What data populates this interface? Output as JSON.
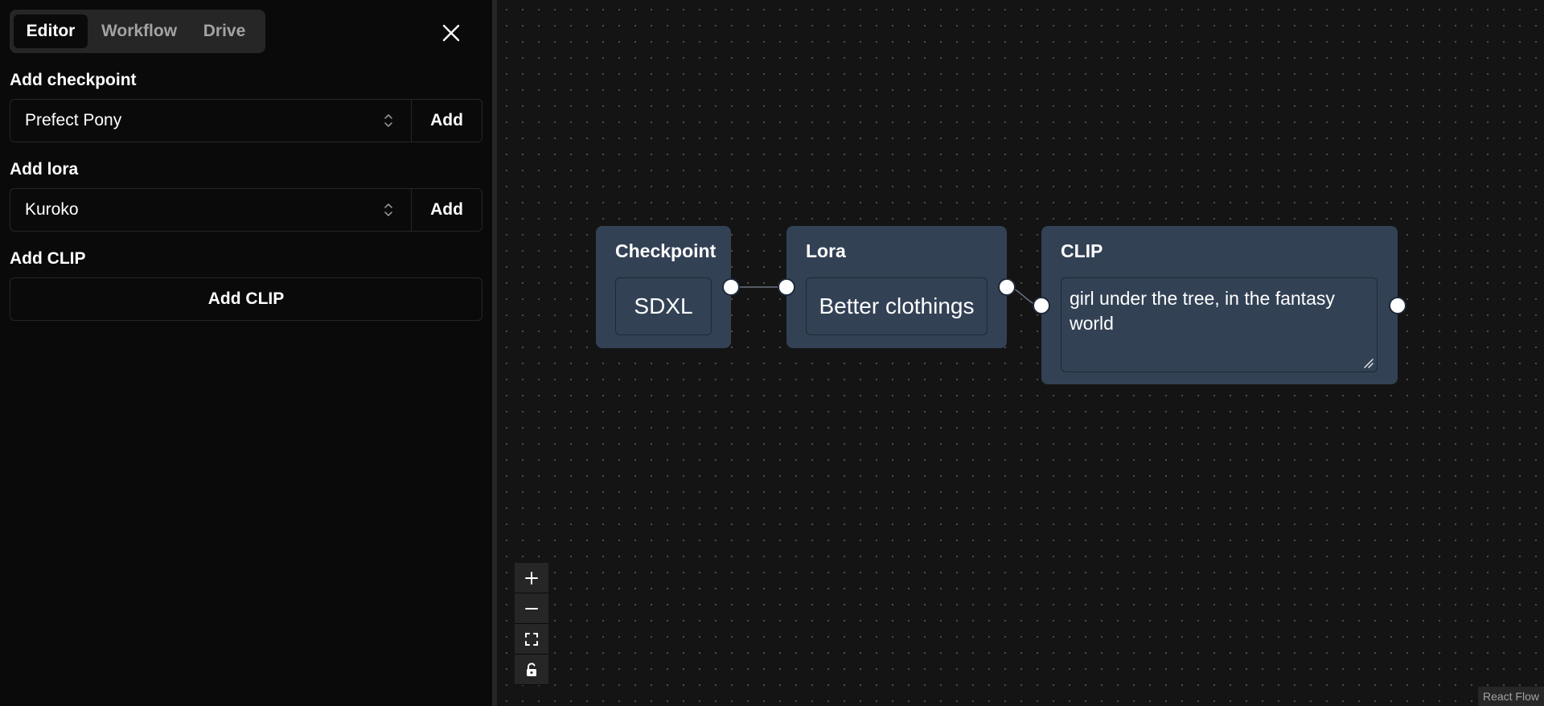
{
  "tabs": [
    {
      "label": "Editor",
      "active": true
    },
    {
      "label": "Workflow",
      "active": false
    },
    {
      "label": "Drive",
      "active": false
    }
  ],
  "close_icon": "close-icon",
  "checkpoint_section": {
    "label": "Add checkpoint",
    "selected": "Prefect Pony",
    "add_label": "Add"
  },
  "lora_section": {
    "label": "Add lora",
    "selected": "Kuroko",
    "add_label": "Add"
  },
  "clip_section": {
    "label": "Add CLIP",
    "button_label": "Add CLIP"
  },
  "nodes": {
    "checkpoint": {
      "title": "Checkpoint",
      "value": "SDXL"
    },
    "lora": {
      "title": "Lora",
      "value": "Better clothings"
    },
    "clip": {
      "title": "CLIP",
      "text": "girl under the tree, in the fantasy world"
    }
  },
  "controls": [
    "zoom-in-icon",
    "zoom-out-icon",
    "fit-view-icon",
    "lock-icon"
  ],
  "attribution": "React Flow",
  "colors": {
    "node_bg": "#334155",
    "panel_bg": "#0a0a0a",
    "canvas_bg": "#141414",
    "border": "#262626"
  }
}
